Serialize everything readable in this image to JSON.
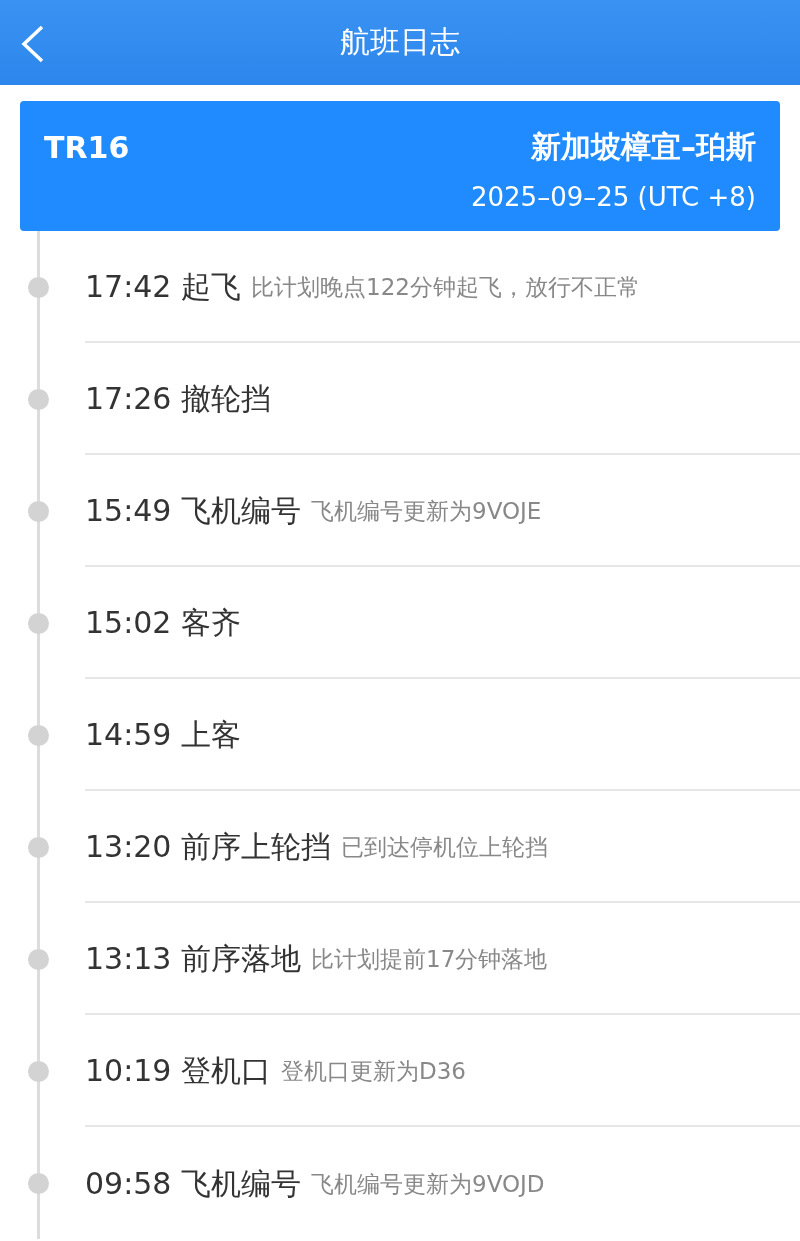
{
  "header": {
    "title": "航班日志"
  },
  "flight": {
    "number": "TR16",
    "route": "新加坡樟宜–珀斯",
    "date": "2025–09–25 (UTC +8)"
  },
  "events": [
    {
      "time": "17:42",
      "title": "起飞",
      "detail": "比计划晚点122分钟起飞，放行不正常"
    },
    {
      "time": "17:26",
      "title": "撤轮挡"
    },
    {
      "time": "15:49",
      "title": "飞机编号",
      "detail": "飞机编号更新为9VOJE"
    },
    {
      "time": "15:02",
      "title": "客齐"
    },
    {
      "time": "14:59",
      "title": "上客"
    },
    {
      "time": "13:20",
      "title": "前序上轮挡",
      "detail": "已到达停机位上轮挡"
    },
    {
      "time": "13:13",
      "title": "前序落地",
      "detail": "比计划提前17分钟落地"
    },
    {
      "time": "10:19",
      "title": "登机口",
      "detail": "登机口更新为D36"
    },
    {
      "time": "09:58",
      "title": "飞机编号",
      "detail": "飞机编号更新为9VOJD"
    }
  ]
}
